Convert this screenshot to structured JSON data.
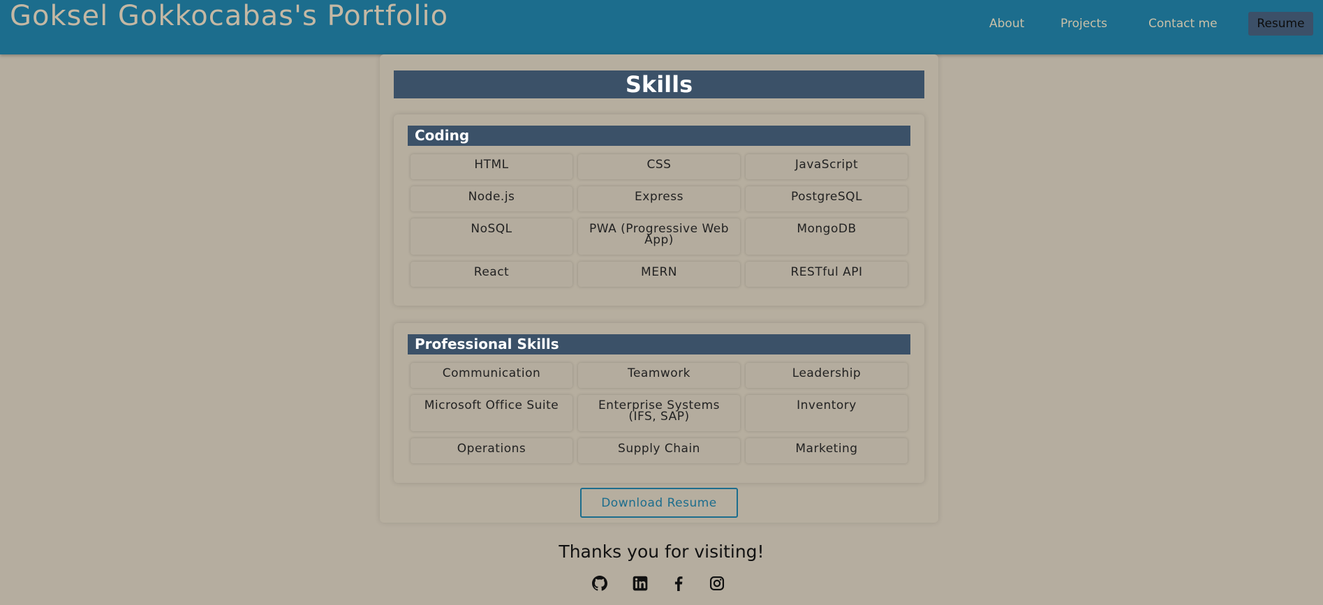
{
  "header": {
    "site_title": "Goksel Gokkocabas's Portfolio",
    "nav": {
      "about": "About",
      "projects": "Projects",
      "contact": "Contact me",
      "resume": "Resume"
    }
  },
  "skills": {
    "title": "Skills",
    "coding": {
      "heading": "Coding",
      "items": [
        "HTML",
        "CSS",
        "JavaScript",
        "Node.js",
        "Express",
        "PostgreSQL",
        "NoSQL",
        "PWA (Progressive Web App)",
        "MongoDB",
        "React",
        "MERN",
        "RESTful API"
      ]
    },
    "professional": {
      "heading": "Professional Skills",
      "items": [
        "Communication",
        "Teamwork",
        "Leadership",
        "Microsoft Office Suite",
        "Enterprise Systems (IFS, SAP)",
        "Inventory",
        "Operations",
        "Supply Chain",
        "Marketing"
      ]
    },
    "download_label": "Download Resume"
  },
  "footer": {
    "thanks": "Thanks you for visiting!",
    "socials": [
      "github-icon",
      "linkedin-icon",
      "facebook-icon",
      "instagram-icon"
    ]
  },
  "colors": {
    "header_bg": "#1c6d8d",
    "page_bg": "#b5ad9f",
    "banner_bg": "#3b5168",
    "title_text": "#c4b8a4"
  }
}
